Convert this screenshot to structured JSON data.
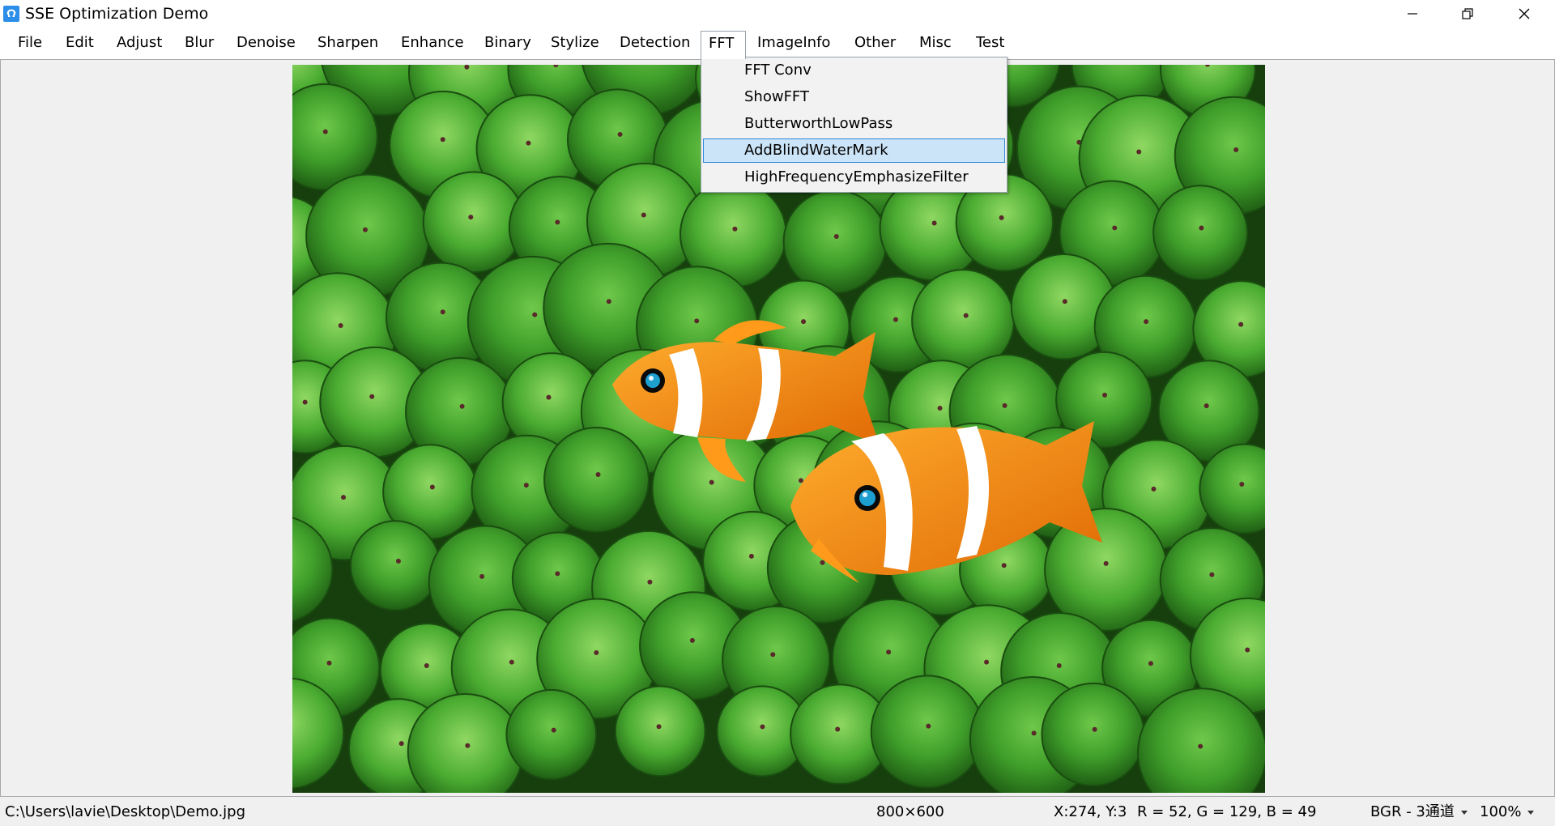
{
  "window": {
    "title": "SSE Optimization Demo",
    "controls": [
      "minimize-icon",
      "restore-icon",
      "close-icon"
    ]
  },
  "menubar": {
    "items": [
      {
        "label": "File"
      },
      {
        "label": "Edit"
      },
      {
        "label": "Adjust"
      },
      {
        "label": "Blur"
      },
      {
        "label": "Denoise"
      },
      {
        "label": "Sharpen"
      },
      {
        "label": "Enhance"
      },
      {
        "label": "Binary"
      },
      {
        "label": "Stylize"
      },
      {
        "label": "Detection"
      },
      {
        "label": "FFT"
      },
      {
        "label": "ImageInfo"
      },
      {
        "label": "Other"
      },
      {
        "label": "Misc"
      },
      {
        "label": "Test"
      }
    ],
    "open_menu": "FFT"
  },
  "fft_menu": {
    "items": [
      {
        "label": "FFT Conv"
      },
      {
        "label": "ShowFFT"
      },
      {
        "label": "ButterworthLowPass"
      },
      {
        "label": "AddBlindWaterMark"
      },
      {
        "label": "HighFrequencyEmphasizeFilter"
      }
    ],
    "highlighted": "AddBlindWaterMark"
  },
  "image": {
    "subject": "clownfish in green sea anemone",
    "width": 800,
    "height": 600
  },
  "statusbar": {
    "file_path": "C:\\Users\\lavie\\Desktop\\Demo.jpg",
    "dimensions": "800×600",
    "cursor_pos": "X:274, Y:3",
    "pixel_value": "R = 52, G = 129, B = 49",
    "channel_mode": "BGR - 3通道",
    "zoom": "100%"
  },
  "colors": {
    "menu_highlight_bg": "#cce4f7",
    "menu_highlight_border": "#2b87d8",
    "app_icon": "#2c8ee8",
    "canvas_bg": "#f0f0f0"
  }
}
